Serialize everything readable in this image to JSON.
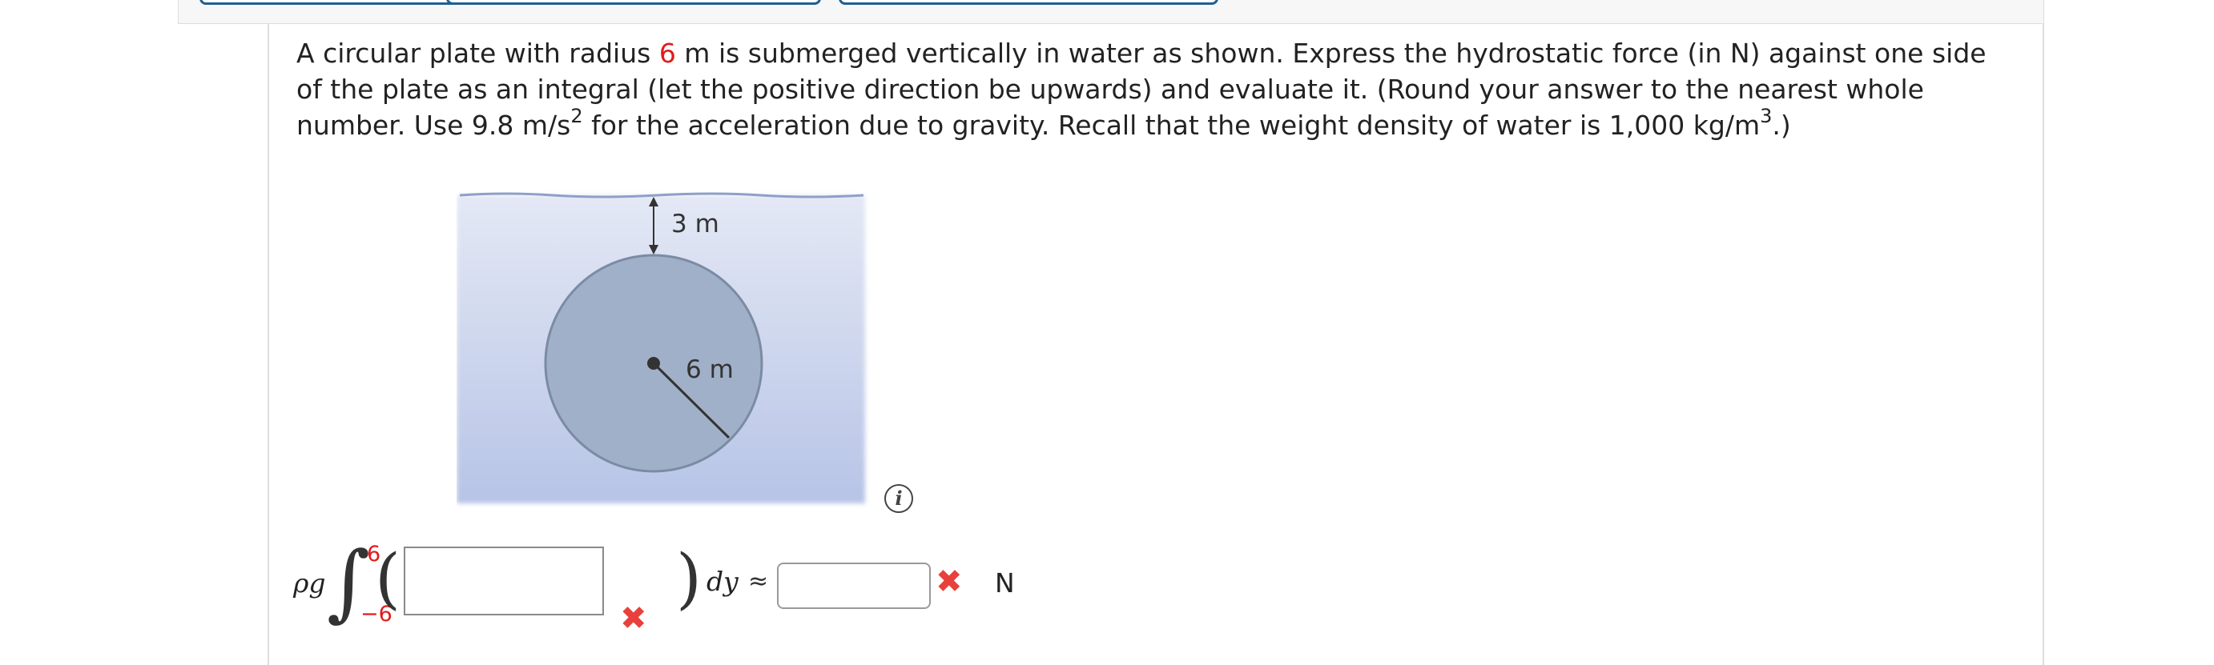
{
  "toolbar": {
    "buttons": [
      "",
      "",
      ""
    ]
  },
  "question": {
    "part1": "A circular plate with radius ",
    "radius": "6",
    "part2": " m is submerged vertically in water as shown. Express the hydrostatic force (in N) against one side of the plate as an integral (let the positive direction be upwards) and evaluate it. (Round your answer to the nearest whole number. Use 9.8 m/s",
    "exp2": "2",
    "part3": " for the acceleration due to gravity. Recall that the weight density of water is 1,000 kg/m",
    "exp3": "3",
    "part4": ".)"
  },
  "figure": {
    "depth_label": "3 m",
    "radius_label": "6 m",
    "colors": {
      "water_top": "#e2e6f4",
      "water_bottom": "#b8c5e6",
      "plate": "#9fb0c9",
      "plate_edge": "#7a8aa0"
    }
  },
  "info_icon": {
    "symbol": "i"
  },
  "answer": {
    "rho_g": "ρg",
    "integral": "∫",
    "upper_limit": "6",
    "lower_limit": "−6",
    "left_paren": "(",
    "right_paren": ")",
    "integrand_value": "",
    "dy": "dy",
    "approx": "≈",
    "result_value": "",
    "unit": "N",
    "incorrect_mark": "✖"
  },
  "colors": {
    "accent": "#1f5f93",
    "error": "#e8413c",
    "given_value": "#e21b1b"
  }
}
